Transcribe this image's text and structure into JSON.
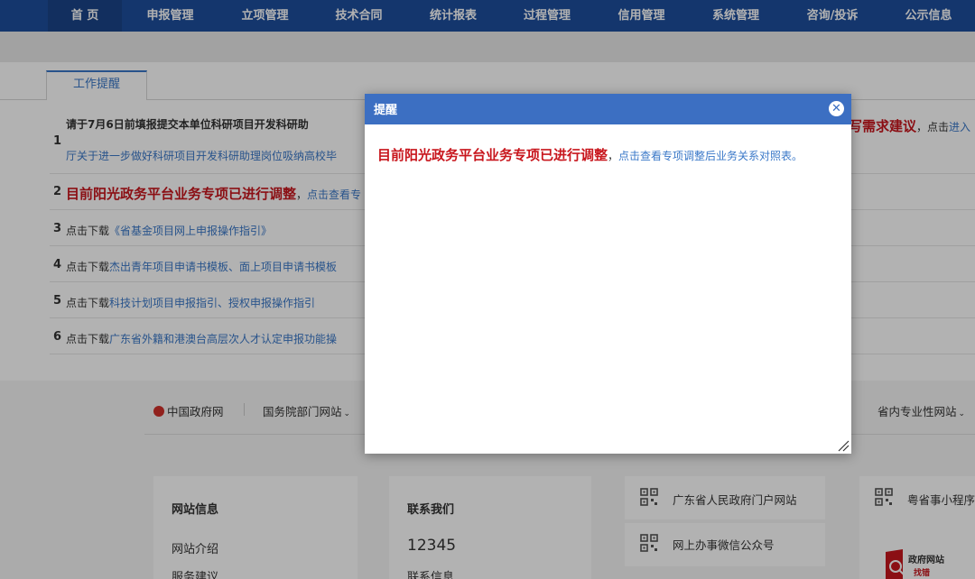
{
  "nav": {
    "items": [
      {
        "label": "首 页",
        "active": true
      },
      {
        "label": "申报管理"
      },
      {
        "label": "立项管理"
      },
      {
        "label": "技术合同"
      },
      {
        "label": "统计报表"
      },
      {
        "label": "过程管理"
      },
      {
        "label": "信用管理"
      },
      {
        "label": "系统管理"
      },
      {
        "label": "咨询/投诉"
      },
      {
        "label": "公示信息"
      }
    ]
  },
  "main": {
    "tab_label": "工作提醒",
    "rows": [
      {
        "num": "1",
        "line1_red": "请于7月6日前填报提交本单位科研项目开发科研助",
        "line1_tail_red": "写需求建议",
        "line1_tail_dark": "，点击",
        "line1_tail_link": "进入",
        "line2_link": "厅关于进一步做好科研项目开发科研助理岗位吸纳高校毕"
      },
      {
        "num": "2",
        "red": "目前阳光政务平台业务专项已进行调整",
        "dark": "，",
        "link": "点击查看专"
      },
      {
        "num": "3",
        "dark": "点击下载",
        "link": "《省基金项目网上申报操作指引》"
      },
      {
        "num": "4",
        "dark": "点击下载",
        "link": "杰出青年项目申请书模板、面上项目申请书模板"
      },
      {
        "num": "5",
        "dark": "点击下载",
        "link": "科技计划项目申报指引、授权申报操作指引"
      },
      {
        "num": "6",
        "dark": "点击下载",
        "link": "广东省外籍和港澳台高层次人才认定申报功能操"
      }
    ]
  },
  "footer": {
    "links": [
      "中国政府网",
      "国务院部门网站",
      "省内专业性网站"
    ],
    "box1": {
      "title": "网站信息",
      "items": [
        "网站介绍",
        "服务建议"
      ]
    },
    "box2": {
      "title": "联系我们",
      "phone": "12345",
      "item": "联系信息"
    },
    "qr_items": [
      "广东省人民政府门户网站",
      "网上办事微信公众号",
      "粤省事小程序"
    ],
    "badge_line1": "政府网站",
    "badge_line2": "找错"
  },
  "modal": {
    "title": "提醒",
    "red": "目前阳光政务平台业务专项已进行调整",
    "dark": "，",
    "link": "点击查看专项调整后业务关系对照表。",
    "close_glyph": "✕"
  },
  "colors": {
    "nav_bg": "#1d4e9c",
    "modal_head": "#3c6fc2",
    "red": "#c8161d",
    "link": "#3a78c8"
  }
}
